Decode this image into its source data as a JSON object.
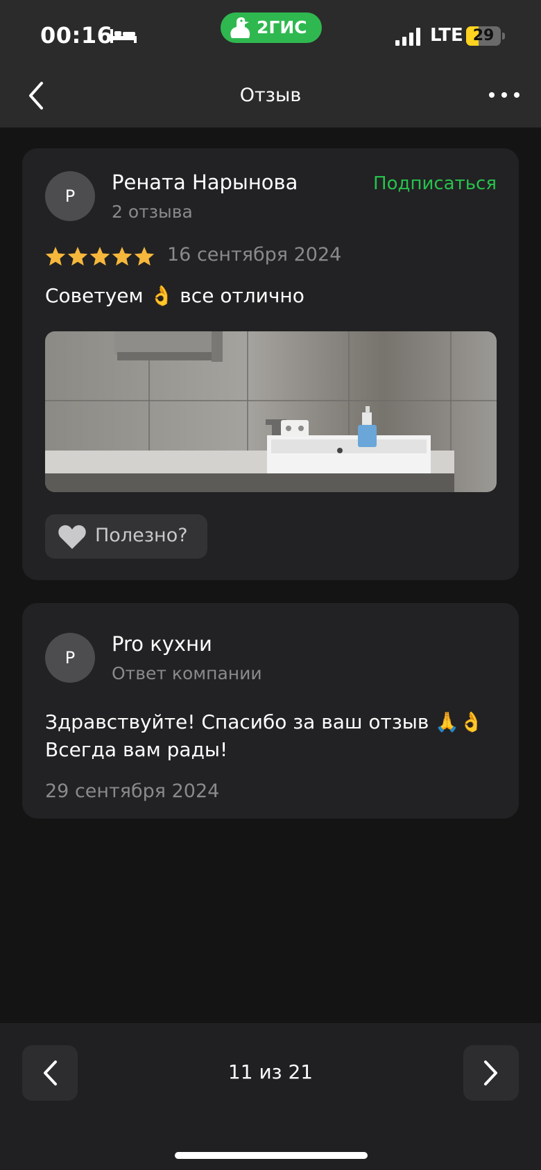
{
  "status_bar": {
    "time": "00:16",
    "bed_icon": "bed-icon",
    "app_brand": "2ГИС",
    "network": "LTE",
    "battery": "29"
  },
  "header": {
    "title": "Отзыв",
    "back_icon": "chevron-left-icon",
    "more_icon": "more-dots-icon"
  },
  "review": {
    "avatar_letter": "Р",
    "author": "Рената Нарынова",
    "author_reviews": "2 отзыва",
    "subscribe_label": "Подписаться",
    "rating": 5,
    "rating_max": 5,
    "date": "16 сентября 2024",
    "text": "Советуем 👌 все отлично",
    "photo_description_icon": "bathroom-photo",
    "useful_label": "Полезно?"
  },
  "reply": {
    "avatar_letter": "Р",
    "author": "Pro кухни",
    "role": "Ответ компании",
    "text": "Здравствуйте! Спасибо за ваш отзыв 🙏👌 Всегда вам рады!",
    "date": "29 сентября 2024"
  },
  "pager": {
    "label": "11 из 21"
  },
  "colors": {
    "accent_green": "#27c24c",
    "star_yellow": "#f6b73c",
    "background": "#141414",
    "card": "#222224"
  }
}
